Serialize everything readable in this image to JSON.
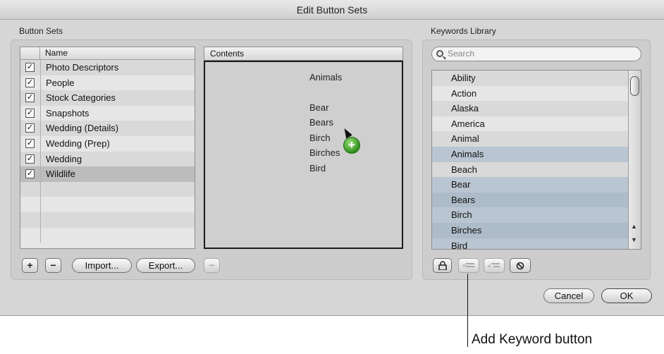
{
  "dialog": {
    "title": "Edit Button Sets",
    "ok_label": "OK",
    "cancel_label": "Cancel"
  },
  "button_sets": {
    "section_label": "Button Sets",
    "column_name": "Name",
    "rows": [
      {
        "label": "Photo Descriptors",
        "checked": true,
        "selected": false
      },
      {
        "label": "People",
        "checked": true,
        "selected": false
      },
      {
        "label": "Stock Categories",
        "checked": true,
        "selected": false
      },
      {
        "label": "Snapshots",
        "checked": true,
        "selected": false
      },
      {
        "label": "Wedding (Details)",
        "checked": true,
        "selected": false
      },
      {
        "label": "Wedding (Prep)",
        "checked": true,
        "selected": false
      },
      {
        "label": "Wedding",
        "checked": true,
        "selected": false
      },
      {
        "label": "Wildlife",
        "checked": true,
        "selected": true
      }
    ],
    "add_label": "+",
    "remove_label": "−",
    "import_label": "Import...",
    "export_label": "Export..."
  },
  "contents": {
    "header": "Contents",
    "items": [
      "Animals",
      "Bear",
      "Bears",
      "Birch",
      "Birches",
      "Bird"
    ],
    "remove_label": "−"
  },
  "keywords_library": {
    "section_label": "Keywords Library",
    "search_placeholder": "Search",
    "items": [
      {
        "label": "Ability",
        "highlighted": false
      },
      {
        "label": "Action",
        "highlighted": false
      },
      {
        "label": "Alaska",
        "highlighted": false
      },
      {
        "label": "America",
        "highlighted": false
      },
      {
        "label": "Animal",
        "highlighted": false
      },
      {
        "label": "Animals",
        "highlighted": true
      },
      {
        "label": "Beach",
        "highlighted": false
      },
      {
        "label": "Bear",
        "highlighted": true
      },
      {
        "label": "Bears",
        "highlighted": true
      },
      {
        "label": "Birch",
        "highlighted": true
      },
      {
        "label": "Birches",
        "highlighted": true
      },
      {
        "label": "Bird",
        "highlighted": true
      }
    ]
  },
  "annotation": {
    "text": "Add Keyword button"
  }
}
